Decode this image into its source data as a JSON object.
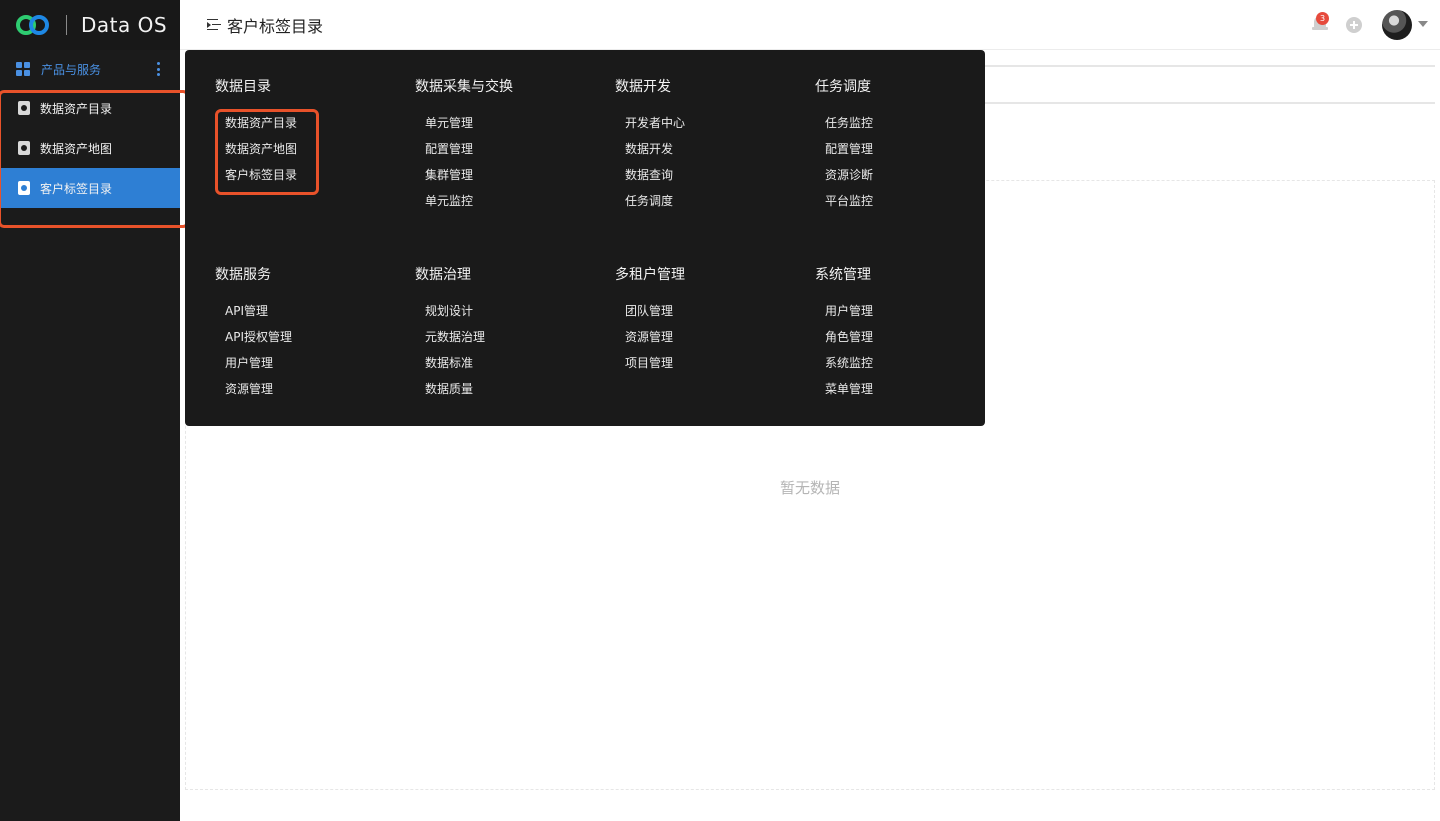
{
  "app": {
    "logo_text": "Data OS"
  },
  "sidebar": {
    "section_label": "产品与服务",
    "items": [
      {
        "label": "数据资产目录",
        "active": false
      },
      {
        "label": "数据资产地图",
        "active": false
      },
      {
        "label": "客户标签目录",
        "active": true
      }
    ]
  },
  "header": {
    "title": "客户标签目录",
    "notification_count": "3"
  },
  "main": {
    "empty_text": "暂无数据"
  },
  "mega_menu": {
    "columns": [
      {
        "category": "数据目录",
        "items": [
          "数据资产目录",
          "数据资产地图",
          "客户标签目录"
        ]
      },
      {
        "category": "数据采集与交换",
        "items": [
          "单元管理",
          "配置管理",
          "集群管理",
          "单元监控"
        ]
      },
      {
        "category": "数据开发",
        "items": [
          "开发者中心",
          "数据开发",
          "数据查询",
          "任务调度"
        ]
      },
      {
        "category": "任务调度",
        "items": [
          "任务监控",
          "配置管理",
          "资源诊断",
          "平台监控"
        ]
      },
      {
        "category": "数据服务",
        "items": [
          "API管理",
          "API授权管理",
          "用户管理",
          "资源管理"
        ]
      },
      {
        "category": "数据治理",
        "items": [
          "规划设计",
          "元数据治理",
          "数据标准",
          "数据质量"
        ]
      },
      {
        "category": "多租户管理",
        "items": [
          "团队管理",
          "资源管理",
          "项目管理"
        ]
      },
      {
        "category": "系统管理",
        "items": [
          "用户管理",
          "角色管理",
          "系统监控",
          "菜单管理"
        ]
      }
    ]
  },
  "colors": {
    "accent": "#2e7fd4",
    "highlight": "#e8522a",
    "sidebar_bg": "#1b1b1b",
    "menu_bg": "#1a1a1a"
  }
}
